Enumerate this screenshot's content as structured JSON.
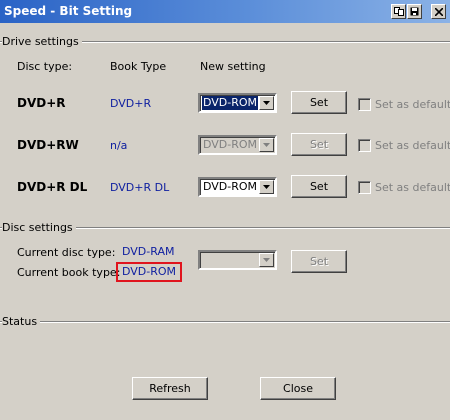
{
  "window": {
    "title": "Speed - Bit Setting"
  },
  "drive_settings": {
    "group_label": "Drive settings",
    "headers": {
      "disc_type": "Disc type:",
      "book_type": "Book Type",
      "new_setting": "New setting"
    },
    "rows": [
      {
        "disc": "DVD+R",
        "book": "DVD+R",
        "setting": "DVD-ROM",
        "enabled": true,
        "set_label": "Set",
        "default_label": "Set as default"
      },
      {
        "disc": "DVD+RW",
        "book": "n/a",
        "setting": "DVD-ROM",
        "enabled": false,
        "set_label": "Set",
        "default_label": "Set as default"
      },
      {
        "disc": "DVD+R DL",
        "book": "DVD+R DL",
        "setting": "DVD-ROM",
        "enabled": true,
        "set_label": "Set",
        "default_label": "Set as default"
      }
    ]
  },
  "disc_settings": {
    "group_label": "Disc settings",
    "current_disc_type_label": "Current disc type:",
    "current_disc_type": "DVD-RAM",
    "current_book_type_label": "Current book type:",
    "current_book_type": "DVD-ROM",
    "set_label": "Set"
  },
  "status": {
    "group_label": "Status"
  },
  "footer": {
    "refresh_label": "Refresh",
    "close_label": "Close"
  },
  "colors": {
    "titlebar": "#2a63c6",
    "value_text": "#1020a0",
    "highlight": "#e0141e",
    "selection": "#0a246a"
  }
}
